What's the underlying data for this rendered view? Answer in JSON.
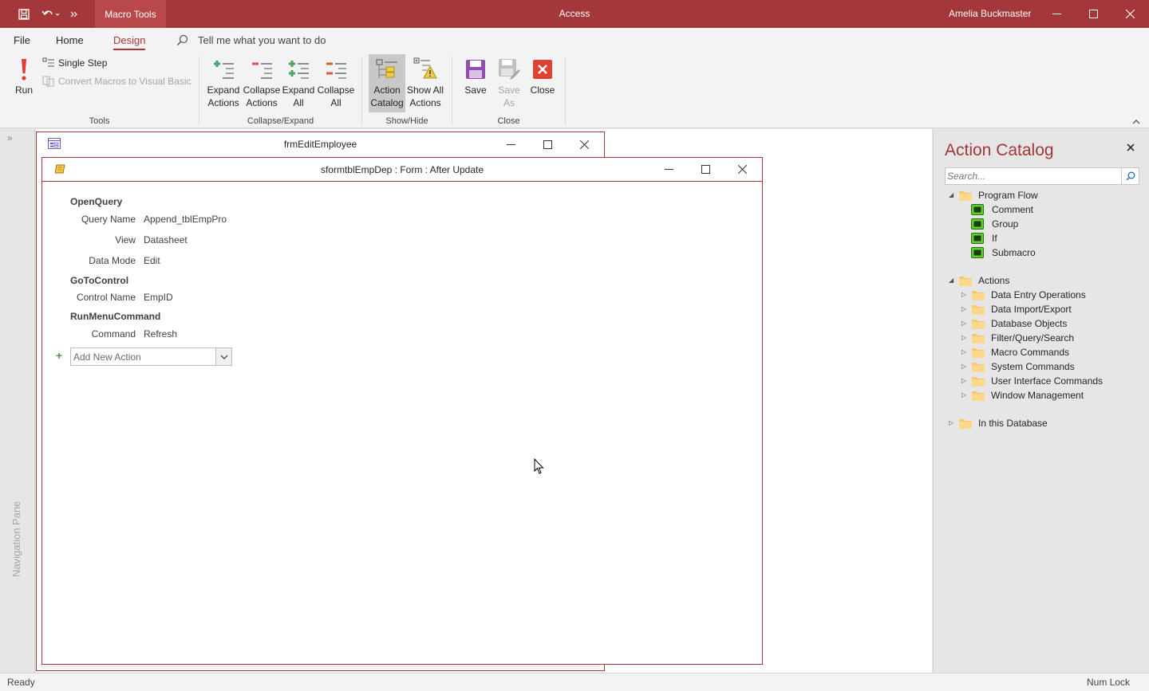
{
  "titlebar": {
    "context_tab": "Macro Tools",
    "app_title": "Access",
    "user_name": "Amelia Buckmaster"
  },
  "ribbon_tabs": {
    "file": "File",
    "home": "Home",
    "design": "Design",
    "tell_me": "Tell me what you want to do"
  },
  "ribbon": {
    "tools": {
      "run": "Run",
      "single_step": "Single Step",
      "convert": "Convert Macros to Visual Basic",
      "label": "Tools"
    },
    "collapse_expand": {
      "expand_actions_1": "Expand",
      "expand_actions_2": "Actions",
      "collapse_actions_1": "Collapse",
      "collapse_actions_2": "Actions",
      "expand_all_1": "Expand",
      "expand_all_2": "All",
      "collapse_all_1": "Collapse",
      "collapse_all_2": "All",
      "label": "Collapse/Expand"
    },
    "show_hide": {
      "action_catalog_1": "Action",
      "action_catalog_2": "Catalog",
      "show_all_1": "Show All",
      "show_all_2": "Actions",
      "label": "Show/Hide"
    },
    "close": {
      "save": "Save",
      "save_as_1": "Save",
      "save_as_2": "As",
      "close": "Close",
      "label": "Close"
    }
  },
  "nav_pane": {
    "label": "Navigation Pane",
    "toggle": "»"
  },
  "form_window": {
    "title": "frmEditEmployee"
  },
  "macro_window": {
    "title": "sformtblEmpDep : Form : After Update",
    "actions": [
      {
        "name": "OpenQuery",
        "args": [
          {
            "label": "Query Name",
            "value": "Append_tblEmpPro"
          },
          {
            "label": "View",
            "value": "Datasheet"
          },
          {
            "label": "Data Mode",
            "value": "Edit"
          }
        ]
      },
      {
        "name": "GoToControl",
        "args": [
          {
            "label": "Control Name",
            "value": "EmpID"
          }
        ]
      },
      {
        "name": "RunMenuCommand",
        "args": [
          {
            "label": "Command",
            "value": "Refresh"
          }
        ]
      }
    ],
    "add_new_action": "Add New Action"
  },
  "catalog": {
    "title": "Action Catalog",
    "search_placeholder": "Search...",
    "program_flow": {
      "label": "Program Flow",
      "items": [
        "Comment",
        "Group",
        "If",
        "Submacro"
      ]
    },
    "actions": {
      "label": "Actions",
      "items": [
        "Data Entry Operations",
        "Data Import/Export",
        "Database Objects",
        "Filter/Query/Search",
        "Macro Commands",
        "System Commands",
        "User Interface Commands",
        "Window Management"
      ]
    },
    "in_db": {
      "label": "In this Database"
    }
  },
  "status": {
    "left": "Ready",
    "right": "Num Lock"
  },
  "colors": {
    "accent": "#a4373a",
    "flow_icon": "#5fcf2f"
  }
}
